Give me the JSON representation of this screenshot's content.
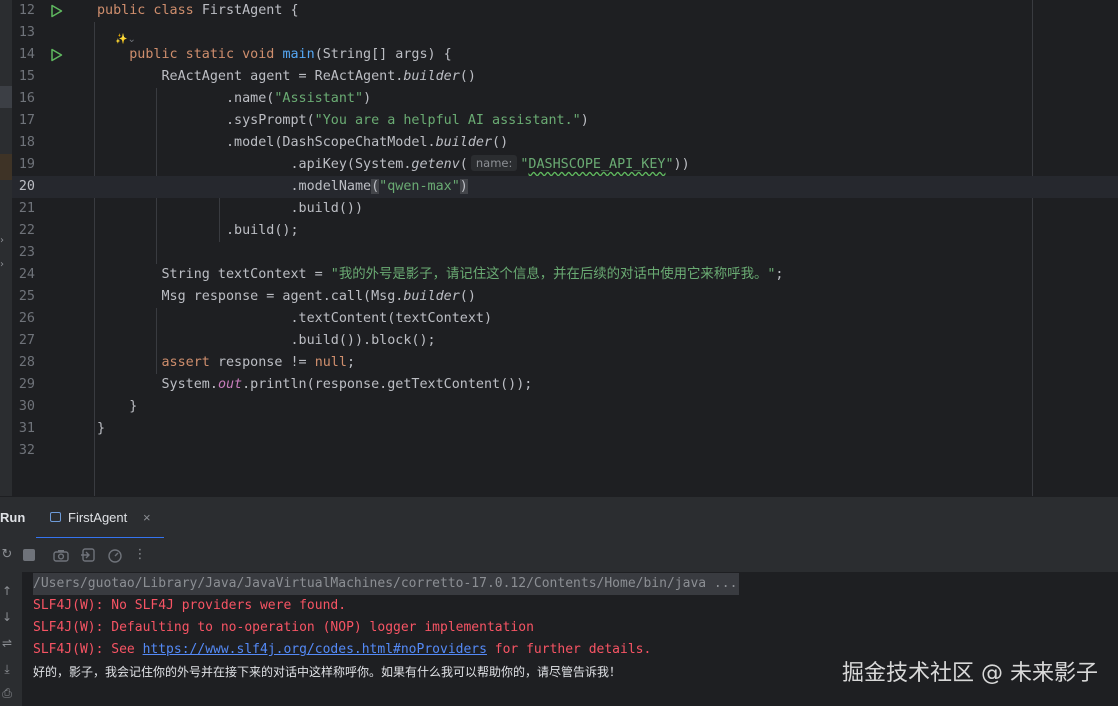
{
  "editor": {
    "ai_hint": "✨⌄",
    "lines": [
      {
        "num": "12",
        "tokens": [
          [
            "kw",
            "public class "
          ],
          [
            "",
            "FirstAgent {"
          ]
        ]
      },
      {
        "num": "13",
        "tokens": []
      },
      {
        "num": "14",
        "tokens": [
          [
            "",
            "    "
          ],
          [
            "kw",
            "public static void "
          ],
          [
            "fn",
            "main"
          ],
          [
            "",
            "(String[] args) {"
          ]
        ]
      },
      {
        "num": "15",
        "tokens": [
          [
            "",
            "        ReActAgent agent = ReActAgent."
          ],
          [
            "it",
            "builder"
          ],
          [
            "",
            "()"
          ]
        ]
      },
      {
        "num": "16",
        "tokens": [
          [
            "",
            "                .name("
          ],
          [
            "str",
            "\"Assistant\""
          ],
          [
            "",
            ")"
          ]
        ]
      },
      {
        "num": "17",
        "tokens": [
          [
            "",
            "                .sysPrompt("
          ],
          [
            "str",
            "\"You are a helpful AI assistant.\""
          ],
          [
            "",
            ")"
          ]
        ]
      },
      {
        "num": "18",
        "tokens": [
          [
            "",
            "                .model(DashScopeChatModel."
          ],
          [
            "it",
            "builder"
          ],
          [
            "",
            "()"
          ]
        ]
      },
      {
        "num": "19",
        "tokens": [
          [
            "",
            "                        .apiKey(System."
          ],
          [
            "it",
            "getenv"
          ],
          [
            "",
            "("
          ],
          [
            "hint",
            "name:"
          ],
          [
            "str",
            "\""
          ],
          [
            "str squiggle",
            "DASHSCOPE_API_KEY"
          ],
          [
            "str",
            "\""
          ],
          [
            "",
            "))"
          ]
        ]
      },
      {
        "num": "20",
        "tokens": [
          [
            "",
            "                        .modelName"
          ],
          [
            "paren-match",
            "("
          ],
          [
            "str",
            "\"qwen-max\""
          ],
          [
            "paren-match",
            ")"
          ]
        ]
      },
      {
        "num": "21",
        "tokens": [
          [
            "",
            "                        .build())"
          ]
        ]
      },
      {
        "num": "22",
        "tokens": [
          [
            "",
            "                .build();"
          ]
        ]
      },
      {
        "num": "23",
        "tokens": []
      },
      {
        "num": "24",
        "tokens": [
          [
            "",
            "        String textContext = "
          ],
          [
            "str",
            "\"我的外号是影子，请记住这个信息，并在后续的对话中使用它来称呼我。\""
          ],
          [
            "",
            ";"
          ]
        ]
      },
      {
        "num": "25",
        "tokens": [
          [
            "",
            "        Msg response = agent.call(Msg."
          ],
          [
            "it",
            "builder"
          ],
          [
            "",
            "()"
          ]
        ]
      },
      {
        "num": "26",
        "tokens": [
          [
            "",
            "                        .textContent(textContext)"
          ]
        ]
      },
      {
        "num": "27",
        "tokens": [
          [
            "",
            "                        .build()).block();"
          ]
        ]
      },
      {
        "num": "28",
        "tokens": [
          [
            "",
            "        "
          ],
          [
            "kw",
            "assert "
          ],
          [
            "",
            "response != "
          ],
          [
            "kw",
            "null"
          ],
          [
            "",
            ";"
          ]
        ]
      },
      {
        "num": "29",
        "tokens": [
          [
            "",
            "        System."
          ],
          [
            "static-f",
            "out"
          ],
          [
            "",
            ".println(response.getTextContent());"
          ]
        ]
      },
      {
        "num": "30",
        "tokens": [
          [
            "",
            "    }"
          ]
        ]
      },
      {
        "num": "31",
        "tokens": [
          [
            "",
            "}"
          ]
        ]
      },
      {
        "num": "32",
        "tokens": []
      }
    ]
  },
  "run_panel": {
    "title": "Run",
    "tab_label": "FirstAgent",
    "tab_close": "×",
    "output": {
      "cmd": "/Users/guotao/Library/Java/JavaVirtualMachines/corretto-17.0.12/Contents/Home/bin/java ...",
      "err1": "SLF4J(W): No SLF4J providers were found.",
      "err2": "SLF4J(W): Defaulting to no-operation (NOP) logger implementation",
      "err3_prefix": "SLF4J(W): See ",
      "err3_link": "https://www.slf4j.org/codes.html#noProviders",
      "err3_suffix": " for further details.",
      "response": "好的，影子，我会记住你的外号并在接下来的对话中这样称呼你。如果有什么我可以帮助你的，请尽管告诉我！"
    }
  },
  "watermark": "掘金技术社区 @ 未来影子",
  "colors": {
    "keyword": "#cf8e6d",
    "string": "#6aab73",
    "method": "#56a8f5",
    "error": "#f75464",
    "link": "#548af7",
    "accent": "#3574f0"
  }
}
